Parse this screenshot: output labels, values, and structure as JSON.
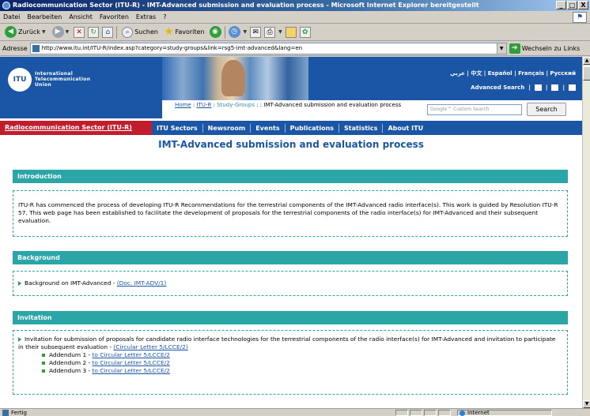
{
  "window": {
    "title": "Radiocommunication Sector (ITU-R) - IMT-Advanced submission and evaluation process - Microsoft Internet Explorer bereitgestellt",
    "controls": [
      "_",
      "□",
      "X"
    ]
  },
  "menu": [
    "Datei",
    "Bearbeiten",
    "Ansicht",
    "Favoriten",
    "Extras",
    "?"
  ],
  "toolbar": {
    "back": "Zurück",
    "search": "Suchen",
    "favorites": "Favoriten"
  },
  "address": {
    "label": "Adresse",
    "url": "http://www.itu.int/ITU-R/index.asp?category=study-groups&link=rsg5-imt-advanced&lang=en",
    "go": "Wechseln zu",
    "links": "Links"
  },
  "status": {
    "text": "Fertig",
    "zone": "Internet"
  },
  "header": {
    "logo": "ITU",
    "org_line1": "International",
    "org_line2": "Telecommunication",
    "org_line3": "Union",
    "languages": "عربي | 中文 | Español | Français | Русский",
    "advanced_search": "Advanced Search",
    "search_placeholder": "Google™ Custom Search",
    "search_button": "Search"
  },
  "breadcrumb": {
    "home": "Home",
    "itu_r": "ITU-R",
    "study_groups": "Study-Groups",
    "current": "IMT-Advanced submission and evaluation process"
  },
  "nav": {
    "current": "Radiocommunication Sector (ITU-R)",
    "items": [
      "ITU Sectors",
      "Newsroom",
      "Events",
      "Publications",
      "Statistics",
      "About ITU"
    ]
  },
  "page": {
    "title": "IMT-Advanced submission and evaluation process",
    "introduction": {
      "heading": "Introduction",
      "text": "ITU-R has commenced the process of developing ITU-R Recommendations for the terrestrial components of the IMT-Advanced radio interface(s). This work is guided by Resolution ITU-R 57. This web page has been established to facilitate the development of proposals for the terrestrial components of the radio interface(s) for IMT-Advanced and their subsequent evaluation."
    },
    "background": {
      "heading": "Background",
      "item_text": "Background on IMT-Advanced - ",
      "item_link": "(Doc. IMT-ADV/1)"
    },
    "invitation": {
      "heading": "Invitation",
      "item_text": "Invitation for submission of proposals for candidate radio interface technologies for the terrestrial components of the radio interface(s) for IMT-Advanced and invitation to participate in their subsequent evaluation - ",
      "item_link": "(Circular Letter 5/LCCE/2)",
      "addenda": [
        {
          "label": "Addendum 1 - ",
          "link": "to Circular Letter 5/LCCE/2"
        },
        {
          "label": "Addendum 2 - ",
          "link": "to Circular Letter 5/LCCE/2"
        },
        {
          "label": "Addendum 3 - ",
          "link": "to Circular Letter 5/LCCE/2"
        }
      ]
    }
  }
}
